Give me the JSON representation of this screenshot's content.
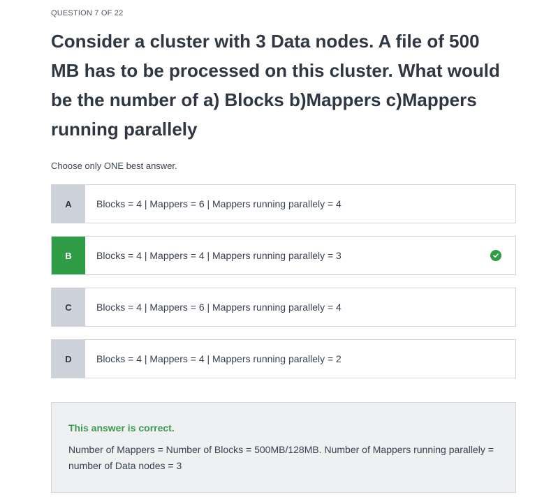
{
  "question": {
    "counter": "QUESTION 7 OF 22",
    "text": "Consider a cluster with 3 Data nodes. A file of 500 MB has to be processed on this cluster. What would be the number of a) Blocks b)Mappers c)Mappers running parallely",
    "instructions": "Choose only ONE best answer."
  },
  "options": [
    {
      "letter": "A",
      "label": "Blocks = 4 | Mappers = 6 | Mappers running parallely = 4",
      "selected": false
    },
    {
      "letter": "B",
      "label": "Blocks = 4 | Mappers = 4 | Mappers running parallely = 3",
      "selected": true
    },
    {
      "letter": "C",
      "label": "Blocks = 4 | Mappers = 6 | Mappers running parallely = 4",
      "selected": false
    },
    {
      "letter": "D",
      "label": "Blocks = 4 | Mappers = 4 | Mappers running parallely = 2",
      "selected": false
    }
  ],
  "feedback": {
    "title": "This answer is correct.",
    "body": "Number of Mappers = Number of Blocks = 500MB/128MB. Number of Mappers running parallely = number of Data nodes = 3"
  },
  "colors": {
    "correct_green": "#2e9d46",
    "option_letter_bg": "#cdd1d9",
    "feedback_bg": "#eef0f2"
  },
  "icons": {
    "correct": "check-circle-icon"
  }
}
